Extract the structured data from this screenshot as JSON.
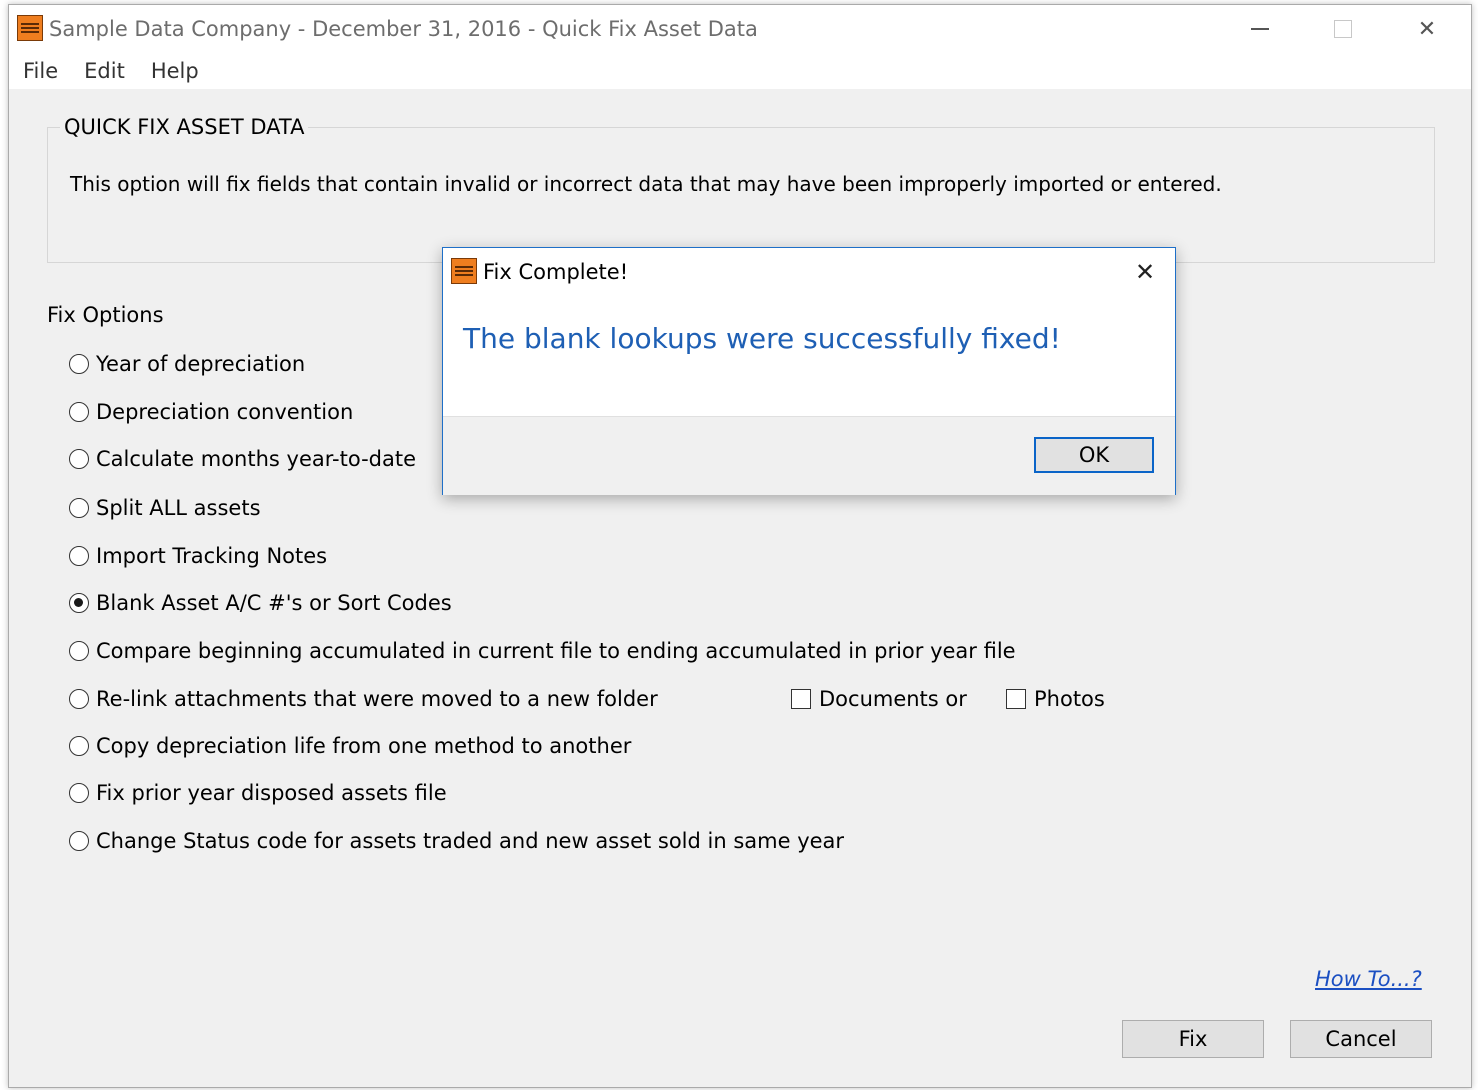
{
  "window": {
    "title": "Sample Data Company - December 31, 2016 - Quick Fix Asset Data",
    "controls": {
      "minimize": "minimize",
      "maximize": "maximize",
      "close": "✕"
    }
  },
  "menu": {
    "items": [
      "File",
      "Edit",
      "Help"
    ]
  },
  "group": {
    "legend": "QUICK FIX ASSET DATA",
    "description": "This option will fix fields that contain invalid or incorrect data that may have been improperly imported or entered."
  },
  "fix_options": {
    "label": "Fix Options",
    "options": [
      {
        "label": "Year of depreciation",
        "checked": false
      },
      {
        "label": "Depreciation convention",
        "checked": false
      },
      {
        "label": "Calculate months year-to-date",
        "checked": false
      },
      {
        "label": "Split ALL assets",
        "checked": false
      },
      {
        "label": "Import Tracking Notes",
        "checked": false
      },
      {
        "label": "Blank Asset A/C #'s or Sort Codes",
        "checked": true
      },
      {
        "label": "Compare beginning accumulated in current file to ending accumulated in prior year file",
        "checked": false
      },
      {
        "label": "Re-link attachments that were moved to a new folder",
        "checked": false
      },
      {
        "label": "Copy depreciation life from one method to another",
        "checked": false
      },
      {
        "label": "Fix prior year disposed assets file",
        "checked": false
      },
      {
        "label": "Change Status code for assets traded and new asset sold in same year",
        "checked": false
      }
    ],
    "attachment_checkboxes": [
      {
        "label": "Documents or",
        "checked": false
      },
      {
        "label": "Photos",
        "checked": false
      }
    ]
  },
  "footer": {
    "howto_link": "How To...?",
    "fix_button": "Fix",
    "cancel_button": "Cancel"
  },
  "dialog": {
    "title": "Fix Complete!",
    "close": "✕",
    "message": "The blank lookups were successfully fixed!",
    "ok_button": "OK",
    "accent_color": "#1e5fb4"
  },
  "icons": [
    "app-icon",
    "minimize-icon",
    "maximize-icon",
    "close-icon"
  ]
}
